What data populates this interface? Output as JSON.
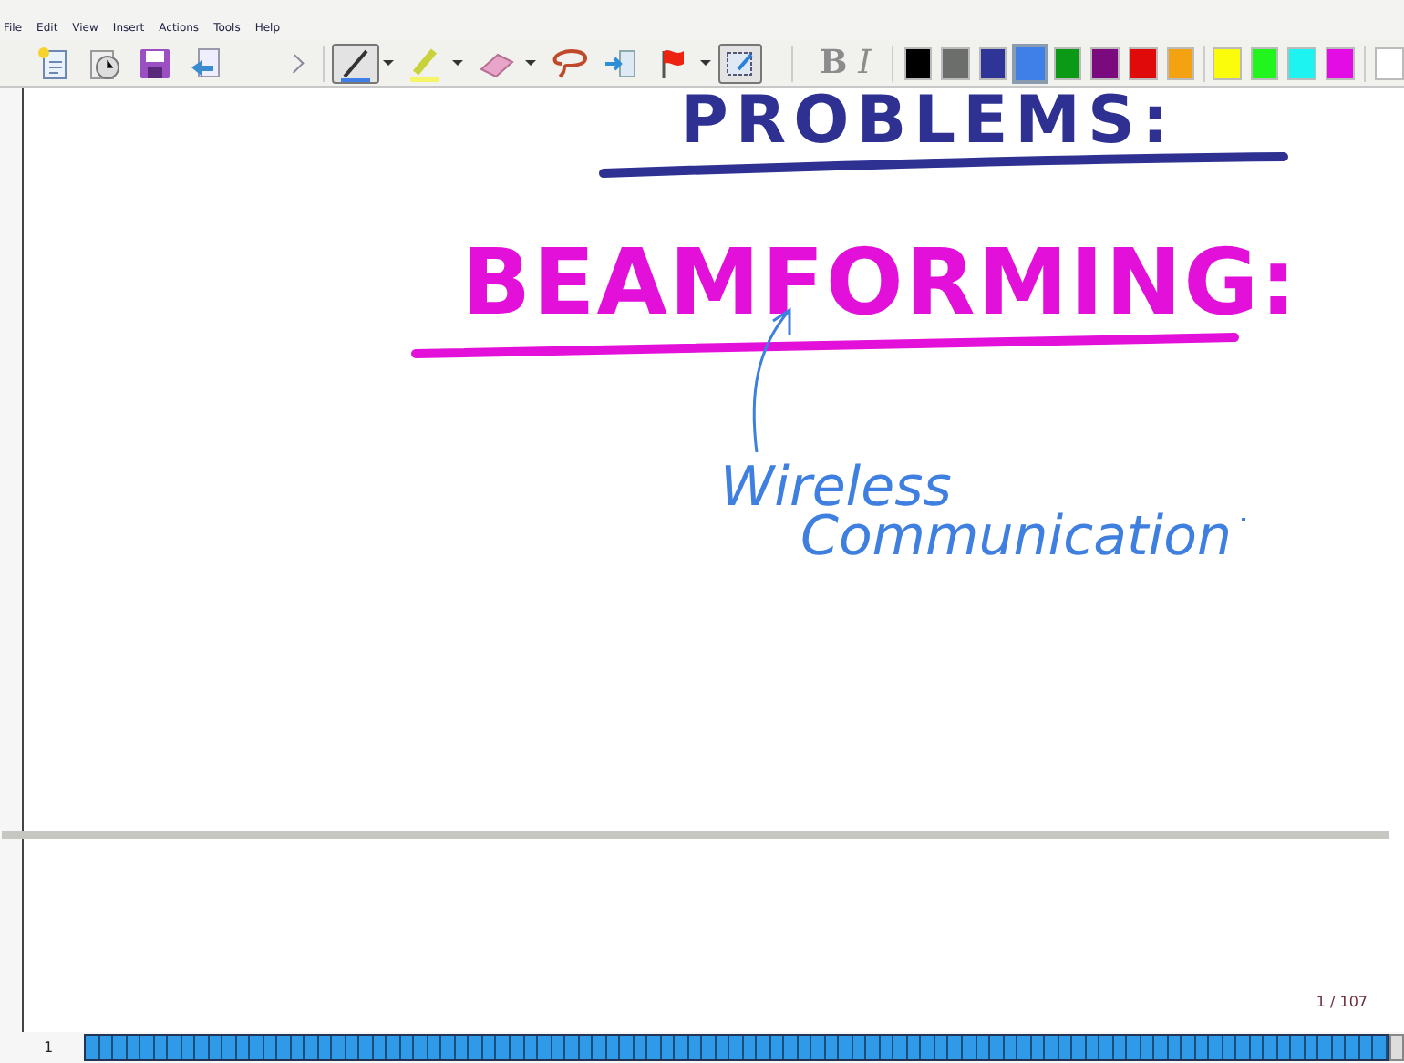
{
  "menu": [
    "File",
    "Edit",
    "View",
    "Insert",
    "Actions",
    "Tools",
    "Help"
  ],
  "tools": [
    {
      "kind": "new",
      "selected": false
    },
    {
      "kind": "open",
      "selected": false
    },
    {
      "kind": "save",
      "selected": false
    },
    {
      "kind": "email",
      "selected": false
    },
    {
      "kind": "pen",
      "selected": true
    },
    {
      "kind": "highlighter",
      "selected": false
    },
    {
      "kind": "eraser",
      "selected": false
    },
    {
      "kind": "lasso",
      "selected": false
    },
    {
      "kind": "space",
      "selected": false
    },
    {
      "kind": "flag",
      "selected": false
    },
    {
      "kind": "select",
      "selected": true
    }
  ],
  "format": [
    {
      "label": "B",
      "disabled": true
    },
    {
      "label": "I",
      "disabled": true
    }
  ],
  "palette": [
    {
      "color": "#000000",
      "selected": false
    },
    {
      "color": "#6b6e6b",
      "selected": false
    },
    {
      "color": "#2f3596",
      "selected": false
    },
    {
      "color": "#3f7fe8",
      "selected": true
    },
    {
      "color": "#0a9a16",
      "selected": false
    },
    {
      "color": "#7a0a7e",
      "selected": false
    },
    {
      "color": "#e10a0a",
      "selected": false
    },
    {
      "color": "#f3a212",
      "selected": false
    },
    {
      "color": "#fbfb0c",
      "selected": false
    },
    {
      "color": "#22f51e",
      "selected": false
    },
    {
      "color": "#1df3f1",
      "selected": false
    },
    {
      "color": "#e40ce4",
      "selected": false
    }
  ],
  "ink": [
    {
      "kind": "heading",
      "text": "PROBLEMS:",
      "color": "#2e3192"
    },
    {
      "kind": "title",
      "text": "BEAMFORMING:",
      "color": "#e210d8"
    },
    {
      "kind": "note",
      "text": "Wireless",
      "color": "#3f7fe0"
    },
    {
      "kind": "note2",
      "text": "Communication",
      "color": "#3f7fe0"
    }
  ],
  "page_indicator": "1 / 107",
  "page_number": "1"
}
